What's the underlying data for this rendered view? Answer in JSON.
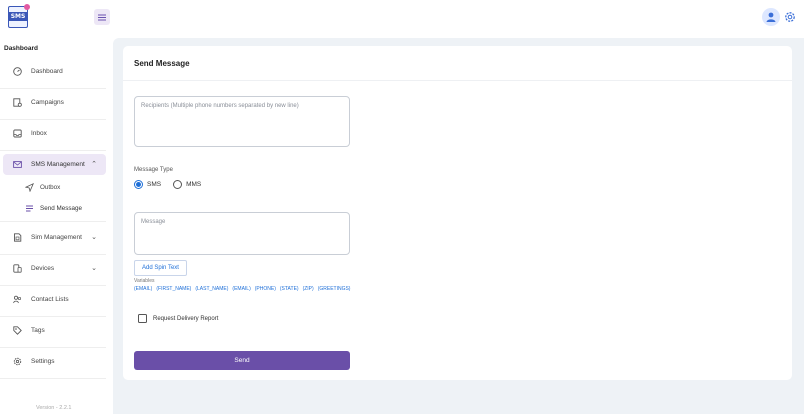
{
  "app": {
    "logo_text": "SMS"
  },
  "sidebar": {
    "section_title": "Dashboard",
    "items": [
      {
        "label": "Dashboard",
        "icon": "dashboard-icon"
      },
      {
        "label": "Campaigns",
        "icon": "campaigns-icon"
      },
      {
        "label": "Inbox",
        "icon": "inbox-icon"
      },
      {
        "label": "SMS Management",
        "icon": "mail-icon",
        "expanded": true
      },
      {
        "label": "Sim Management",
        "icon": "sim-icon"
      },
      {
        "label": "Devices",
        "icon": "devices-icon"
      },
      {
        "label": "Contact Lists",
        "icon": "contacts-icon"
      },
      {
        "label": "Tags",
        "icon": "tag-icon"
      },
      {
        "label": "Settings",
        "icon": "gear-icon"
      }
    ],
    "sub_items": [
      {
        "label": "Outbox",
        "icon": "send-icon"
      },
      {
        "label": "Send Message",
        "icon": "message-icon"
      }
    ],
    "version": "Version - 2.2.1"
  },
  "main": {
    "title": "Send Message",
    "recipients_placeholder": "Recipients (Multiple phone numbers separated by new line)",
    "message_type_label": "Message Type",
    "radio_options": [
      {
        "label": "SMS",
        "selected": true
      },
      {
        "label": "MMS",
        "selected": false
      }
    ],
    "message_placeholder": "Message",
    "spin_button": "Add Spin Text",
    "variables_label": "Variables",
    "variables": [
      "(EMAIL)",
      "(FIRST_NAME)",
      "(LAST_NAME)",
      "(EMAIL)",
      "(PHONE)",
      "(STATE)",
      "(ZIP)",
      "(GREETINGS)"
    ],
    "delivery_report_label": "Request Delivery Report",
    "send_button": "Send"
  },
  "colors": {
    "accent": "#6a4fa8",
    "link": "#1e6fd8",
    "background": "#eef2f6"
  }
}
